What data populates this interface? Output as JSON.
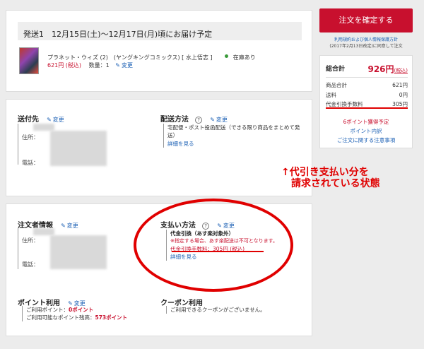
{
  "shipment": {
    "title": "発送1　12月15日(土)～12月17日(月)頃にお届け予定",
    "item_title": "プラネット・ウィズ (2)　(ヤングキングコミックス) [ 水上悟志 ]",
    "stock": "在庫あり",
    "price": "621円 (税込)",
    "quantity": "数量：1",
    "edit": "変更"
  },
  "delivery": {
    "address_title": "送付先",
    "address_edit": "変更",
    "address_label": "住所：",
    "phone_label": "電話：",
    "method_title": "配送方法",
    "method_edit": "変更",
    "method_desc": "宅配便・ポスト投函配送（できる限り商品をまとめて発送）",
    "method_more": "詳細を見る"
  },
  "annotation": {
    "line1": "↑代引き支払い分を",
    "line2": "請求されている状態"
  },
  "orderer": {
    "title": "注文者情報",
    "edit": "変更",
    "address_label": "住所：",
    "phone_label": "電話："
  },
  "payment": {
    "title": "支払い方法",
    "edit": "変更",
    "name": "代金引換（あす楽対象外）",
    "note": "※指定する場合、あす楽配送は不可となります。",
    "fee": "代金引換手数料：305円 (税込)",
    "more": "詳細を見る"
  },
  "points": {
    "title": "ポイント利用",
    "edit": "変更",
    "used_label": "ご利用ポイント：",
    "used_value": "0ポイント",
    "available_label": "ご利用可能なポイント残高：",
    "available_value": "573ポイント"
  },
  "coupon": {
    "title": "クーポン利用",
    "desc": "ご利用できるクーポンがございません。"
  },
  "summary": {
    "confirm_button": "注文を確定する",
    "terms_link": "利用規約および個人情報保護方針",
    "terms_note": "(2017年2月13日改定)に同意して注文",
    "total_label": "総合計",
    "total_value": "926円",
    "tax": "(税込)",
    "subtotal_label": "商品合計",
    "subtotal_value": "621円",
    "shipping_label": "送料",
    "shipping_value": "0円",
    "cod_label": "代金引換手数料",
    "cod_value": "305円",
    "points_earn": "6ポイント獲得予定",
    "points_detail": "ポイント内訳",
    "notice": "ご注文に関する注意事項"
  },
  "colors": {
    "brand_red": "#c8102e",
    "link_blue": "#1a5fb4",
    "stock_green": "#3a9a3a"
  }
}
